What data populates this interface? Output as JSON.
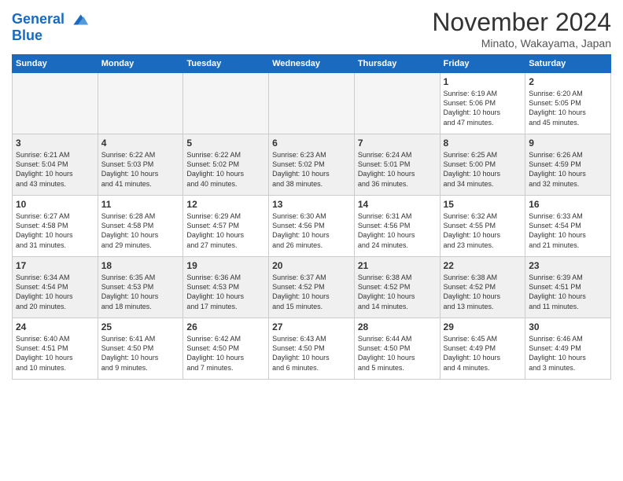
{
  "header": {
    "logo_line1": "General",
    "logo_line2": "Blue",
    "month": "November 2024",
    "location": "Minato, Wakayama, Japan"
  },
  "days_of_week": [
    "Sunday",
    "Monday",
    "Tuesday",
    "Wednesday",
    "Thursday",
    "Friday",
    "Saturday"
  ],
  "weeks": [
    [
      {
        "day": "",
        "info": "",
        "empty": true
      },
      {
        "day": "",
        "info": "",
        "empty": true
      },
      {
        "day": "",
        "info": "",
        "empty": true
      },
      {
        "day": "",
        "info": "",
        "empty": true
      },
      {
        "day": "",
        "info": "",
        "empty": true
      },
      {
        "day": "1",
        "info": "Sunrise: 6:19 AM\nSunset: 5:06 PM\nDaylight: 10 hours\nand 47 minutes."
      },
      {
        "day": "2",
        "info": "Sunrise: 6:20 AM\nSunset: 5:05 PM\nDaylight: 10 hours\nand 45 minutes."
      }
    ],
    [
      {
        "day": "3",
        "info": "Sunrise: 6:21 AM\nSunset: 5:04 PM\nDaylight: 10 hours\nand 43 minutes."
      },
      {
        "day": "4",
        "info": "Sunrise: 6:22 AM\nSunset: 5:03 PM\nDaylight: 10 hours\nand 41 minutes."
      },
      {
        "day": "5",
        "info": "Sunrise: 6:22 AM\nSunset: 5:02 PM\nDaylight: 10 hours\nand 40 minutes."
      },
      {
        "day": "6",
        "info": "Sunrise: 6:23 AM\nSunset: 5:02 PM\nDaylight: 10 hours\nand 38 minutes."
      },
      {
        "day": "7",
        "info": "Sunrise: 6:24 AM\nSunset: 5:01 PM\nDaylight: 10 hours\nand 36 minutes."
      },
      {
        "day": "8",
        "info": "Sunrise: 6:25 AM\nSunset: 5:00 PM\nDaylight: 10 hours\nand 34 minutes."
      },
      {
        "day": "9",
        "info": "Sunrise: 6:26 AM\nSunset: 4:59 PM\nDaylight: 10 hours\nand 32 minutes."
      }
    ],
    [
      {
        "day": "10",
        "info": "Sunrise: 6:27 AM\nSunset: 4:58 PM\nDaylight: 10 hours\nand 31 minutes."
      },
      {
        "day": "11",
        "info": "Sunrise: 6:28 AM\nSunset: 4:58 PM\nDaylight: 10 hours\nand 29 minutes."
      },
      {
        "day": "12",
        "info": "Sunrise: 6:29 AM\nSunset: 4:57 PM\nDaylight: 10 hours\nand 27 minutes."
      },
      {
        "day": "13",
        "info": "Sunrise: 6:30 AM\nSunset: 4:56 PM\nDaylight: 10 hours\nand 26 minutes."
      },
      {
        "day": "14",
        "info": "Sunrise: 6:31 AM\nSunset: 4:56 PM\nDaylight: 10 hours\nand 24 minutes."
      },
      {
        "day": "15",
        "info": "Sunrise: 6:32 AM\nSunset: 4:55 PM\nDaylight: 10 hours\nand 23 minutes."
      },
      {
        "day": "16",
        "info": "Sunrise: 6:33 AM\nSunset: 4:54 PM\nDaylight: 10 hours\nand 21 minutes."
      }
    ],
    [
      {
        "day": "17",
        "info": "Sunrise: 6:34 AM\nSunset: 4:54 PM\nDaylight: 10 hours\nand 20 minutes."
      },
      {
        "day": "18",
        "info": "Sunrise: 6:35 AM\nSunset: 4:53 PM\nDaylight: 10 hours\nand 18 minutes."
      },
      {
        "day": "19",
        "info": "Sunrise: 6:36 AM\nSunset: 4:53 PM\nDaylight: 10 hours\nand 17 minutes."
      },
      {
        "day": "20",
        "info": "Sunrise: 6:37 AM\nSunset: 4:52 PM\nDaylight: 10 hours\nand 15 minutes."
      },
      {
        "day": "21",
        "info": "Sunrise: 6:38 AM\nSunset: 4:52 PM\nDaylight: 10 hours\nand 14 minutes."
      },
      {
        "day": "22",
        "info": "Sunrise: 6:38 AM\nSunset: 4:52 PM\nDaylight: 10 hours\nand 13 minutes."
      },
      {
        "day": "23",
        "info": "Sunrise: 6:39 AM\nSunset: 4:51 PM\nDaylight: 10 hours\nand 11 minutes."
      }
    ],
    [
      {
        "day": "24",
        "info": "Sunrise: 6:40 AM\nSunset: 4:51 PM\nDaylight: 10 hours\nand 10 minutes."
      },
      {
        "day": "25",
        "info": "Sunrise: 6:41 AM\nSunset: 4:50 PM\nDaylight: 10 hours\nand 9 minutes."
      },
      {
        "day": "26",
        "info": "Sunrise: 6:42 AM\nSunset: 4:50 PM\nDaylight: 10 hours\nand 7 minutes."
      },
      {
        "day": "27",
        "info": "Sunrise: 6:43 AM\nSunset: 4:50 PM\nDaylight: 10 hours\nand 6 minutes."
      },
      {
        "day": "28",
        "info": "Sunrise: 6:44 AM\nSunset: 4:50 PM\nDaylight: 10 hours\nand 5 minutes."
      },
      {
        "day": "29",
        "info": "Sunrise: 6:45 AM\nSunset: 4:49 PM\nDaylight: 10 hours\nand 4 minutes."
      },
      {
        "day": "30",
        "info": "Sunrise: 6:46 AM\nSunset: 4:49 PM\nDaylight: 10 hours\nand 3 minutes."
      }
    ]
  ]
}
